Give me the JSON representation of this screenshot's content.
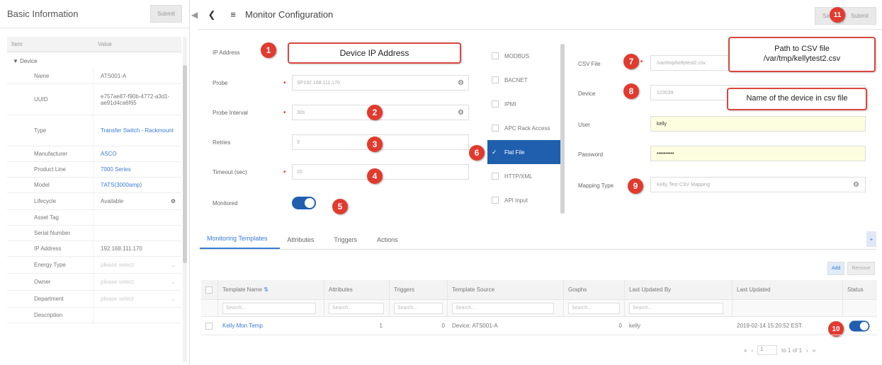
{
  "left_panel": {
    "title": "Basic Information",
    "submit_label": "Submit",
    "columns": [
      "Item",
      "Value"
    ],
    "group": "▼ Device",
    "rows": [
      {
        "key": "Name",
        "value": "ATS001-A"
      },
      {
        "key": "UUID",
        "value": "e757ae87-f90b-4772-a3d1-ae91d4ca6f65"
      },
      {
        "key": "Type",
        "value": "Transfer Switch - Rackmount"
      },
      {
        "key": "Manufacturer",
        "value": "ASCO"
      },
      {
        "key": "Product Line",
        "value": "7000 Series"
      },
      {
        "key": "Model",
        "value": "7ATS(3000amp)"
      },
      {
        "key": "Lifecycle",
        "value": "Available"
      },
      {
        "key": "Asset Tag",
        "value": ""
      },
      {
        "key": "Serial Number",
        "value": ""
      },
      {
        "key": "IP Address",
        "value": "192.168.111.170"
      },
      {
        "key": "Energy Type",
        "value": "placeholder"
      },
      {
        "key": "Owner",
        "value": "placeholder"
      },
      {
        "key": "Department",
        "value": "placeholder"
      },
      {
        "key": "Description",
        "value": ""
      }
    ]
  },
  "header": {
    "title": "Monitor Configuration",
    "save_label": "Save",
    "submit_label": "Submit"
  },
  "form": {
    "ip_label": "IP Address",
    "probe_label": "Probe",
    "probe_value": "SP192.168.111.170",
    "interval_label": "Probe Interval",
    "interval_value": "30s",
    "retries_label": "Retries",
    "retries_value": "3",
    "timeout_label": "Timeout (sec)",
    "timeout_value": "10",
    "monitored_label": "Monitored"
  },
  "protocols": [
    "MODBUS",
    "BACNET",
    "IPMI",
    "APC Rack Access",
    "Flat File",
    "HTTP/XML",
    "API Input"
  ],
  "csv": {
    "file_label": "CSV File",
    "file_value": "/var/tmp/kellytest2.csv",
    "device_label": "Device",
    "device_value": "123039",
    "user_label": "User",
    "user_value": "kelly",
    "password_label": "Password",
    "password_value": "••••••••••",
    "mapping_label": "Mapping Type",
    "mapping_value": "Kelly Test CSV Mapping"
  },
  "callouts": {
    "ip": "Device IP Address",
    "csv_path": "Path to CSV file\n/var/tmp/kellytest2.csv",
    "device_name": "Name of the device in csv file"
  },
  "badges": [
    "1",
    "2",
    "3",
    "4",
    "5",
    "6",
    "7",
    "8",
    "9",
    "10",
    "11"
  ],
  "tabs": [
    "Monitoring Templates",
    "Attributes",
    "Triggers",
    "Actions"
  ],
  "tab_plus": "+",
  "table": {
    "add_label": "Add",
    "remove_label": "Remove",
    "columns": [
      "Template Name",
      "Attributes",
      "Triggers",
      "Template Source",
      "Graphs",
      "Last Updated By",
      "Last Updated",
      "Status"
    ],
    "filter_placeholder": "Search...",
    "row": {
      "name": "Kelly Mon Temp",
      "attributes": "1",
      "triggers": "0",
      "source": "Device: ATS001-A",
      "graphs": "0",
      "updated_by": "kelly",
      "updated": "2019-02-14 15:20:52 EST"
    }
  },
  "pager": {
    "first": "«",
    "prev": "‹",
    "page": "1",
    "of": "to 1 of 1",
    "next": "›",
    "last": "»"
  }
}
